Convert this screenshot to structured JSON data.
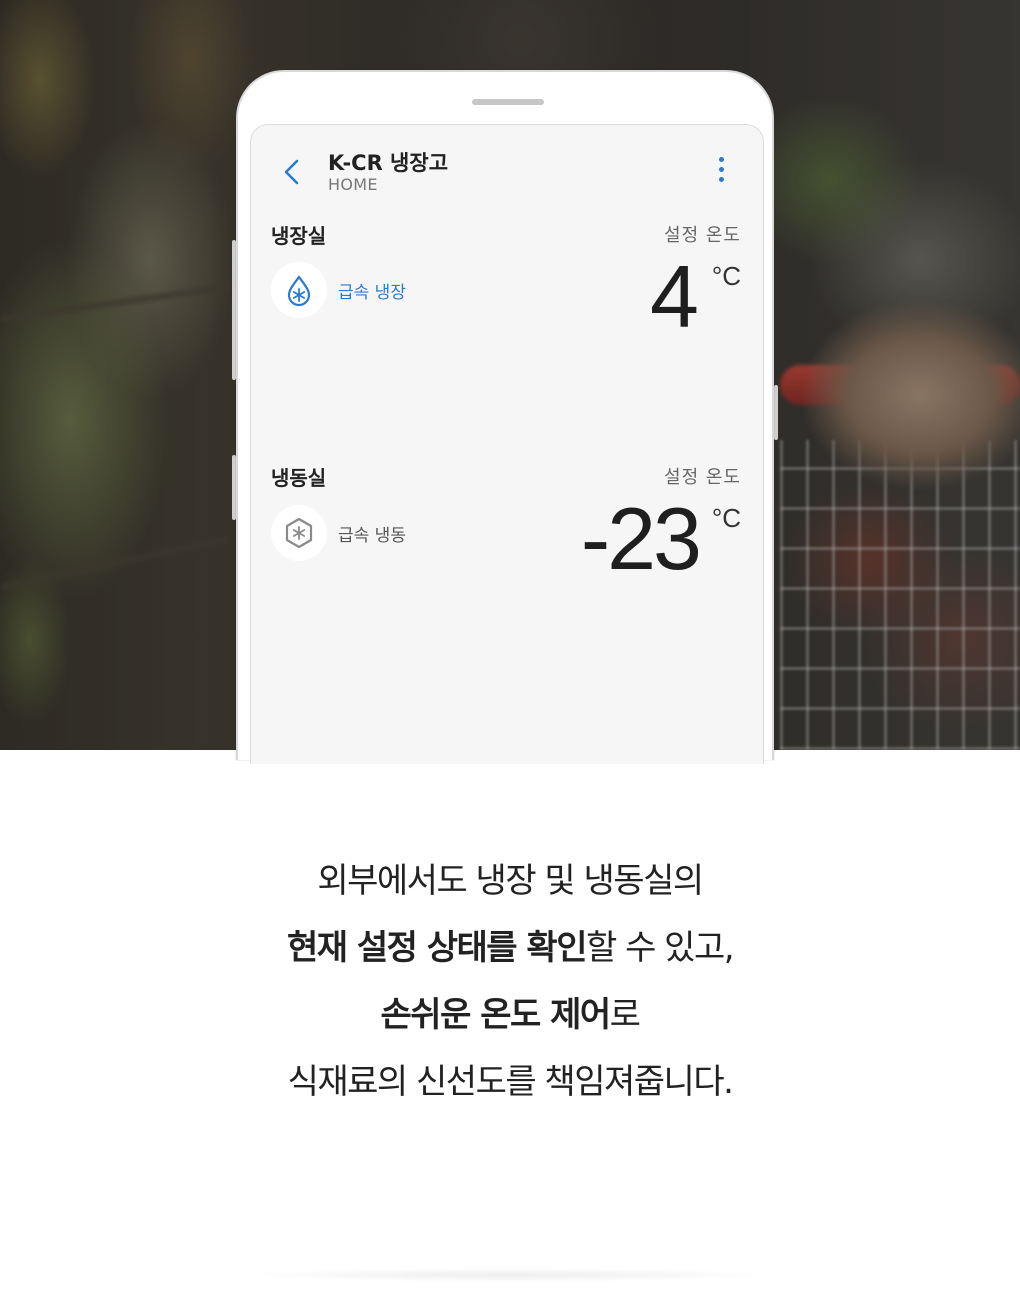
{
  "app": {
    "title": "K-CR 냉장고",
    "subtitle": "HOME"
  },
  "fridge": {
    "section": "냉장실",
    "set_label": "설정 온도",
    "mode_label": "급속 냉장",
    "mode_icon": "water-drop-snowflake-icon",
    "temperature": "4",
    "unit": "°C",
    "accent_color": "#2a7bd0"
  },
  "freezer": {
    "section": "냉동실",
    "set_label": "설정 온도",
    "mode_label": "급속 냉동",
    "mode_icon": "hexagon-snowflake-icon",
    "temperature": "-23",
    "unit": "°C"
  },
  "caption": {
    "line1": "외부에서도 냉장 및 냉동실의",
    "line2_bold": "현재 설정 상태를 확인",
    "line2_rest": "할 수 있고,",
    "line3_bold": "손쉬운 온도 제어",
    "line3_rest": "로",
    "line4": "식재료의 신선도를 책임져줍니다."
  }
}
